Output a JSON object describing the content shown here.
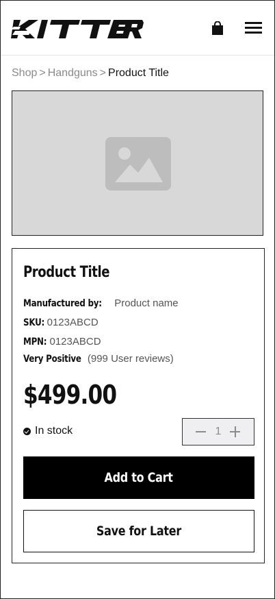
{
  "header": {
    "logo_text": "KITTER",
    "bag_icon": "shopping-bag-icon",
    "menu_icon": "hamburger-menu-icon"
  },
  "breadcrumb": {
    "items": [
      "Shop",
      "Handguns"
    ],
    "separator": ">",
    "current": "Product Title"
  },
  "product": {
    "image_icon": "image-placeholder-icon",
    "title": "Product Title",
    "manufacturer_label": "Manufactured by:",
    "manufacturer_value": "Product name",
    "sku_label": "SKU:",
    "sku_value": "0123ABCD",
    "mpn_label": "MPN:",
    "mpn_value": "0123ABCD",
    "rating_label": "Very Positive",
    "rating_value": "(999 User reviews)",
    "price": "$499.00",
    "stock_text": "In stock",
    "quantity": "1"
  },
  "actions": {
    "add_to_cart": "Add to Cart",
    "save_for_later": "Save for Later"
  },
  "colors": {
    "primary": "#000000",
    "image_bg": "#d8d8d8",
    "muted_text": "#8a8a8a",
    "stepper_bg": "#efeff2"
  }
}
